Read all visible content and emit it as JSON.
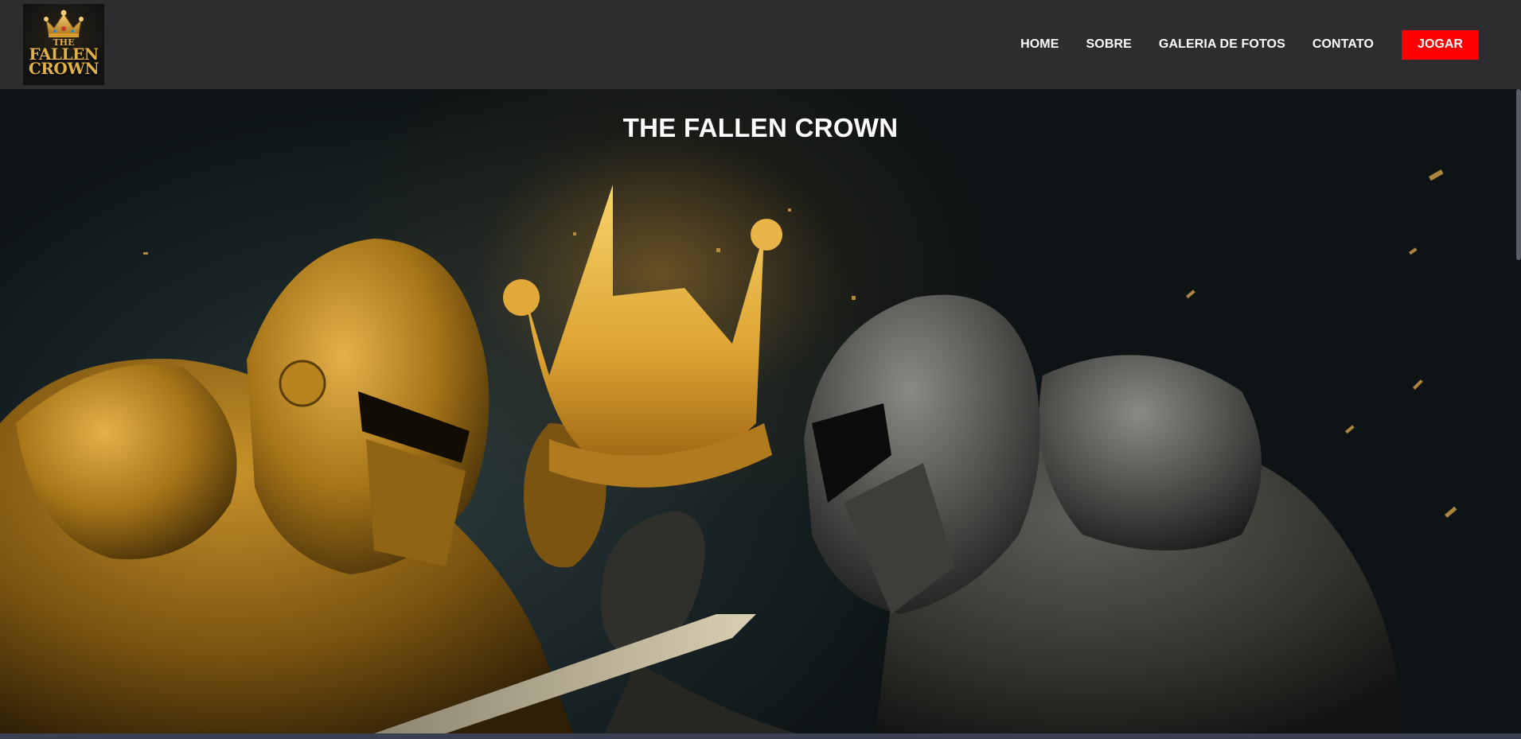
{
  "header": {
    "logo": {
      "icon": "crown-icon",
      "line1": "THE",
      "line2": "FALLEN",
      "line3": "CROWN",
      "color": "#e0b049"
    },
    "nav": [
      {
        "label": "HOME"
      },
      {
        "label": "SOBRE"
      },
      {
        "label": "GALERIA DE FOTOS"
      },
      {
        "label": "CONTATO"
      }
    ],
    "play_label": "JOGAR",
    "play_color": "#ff0000",
    "background": "#2d2d30"
  },
  "hero": {
    "title": "THE FALLEN CROWN",
    "image_alt": "hero-knights-artwork"
  }
}
